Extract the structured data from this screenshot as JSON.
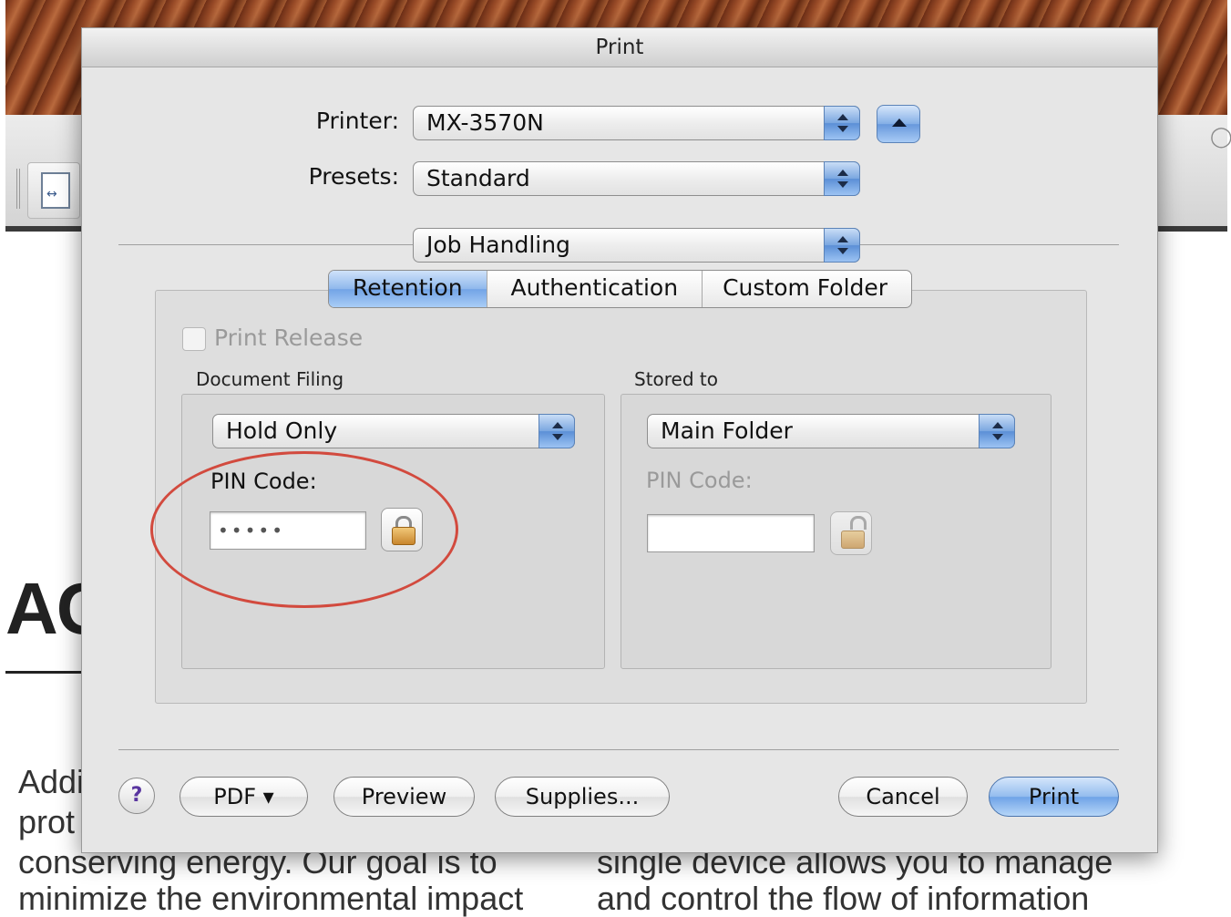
{
  "background": {
    "heading": "AG",
    "text_left": [
      "Addi",
      "prot",
      "conserving energy. Our goal is to",
      "minimize the environmental impact"
    ],
    "text_right": [
      "single device allows you to manage",
      "and control the flow of information"
    ]
  },
  "dialog": {
    "title": "Print",
    "printer_label": "Printer:",
    "printer_value": "MX-3570N",
    "presets_label": "Presets:",
    "presets_value": "Standard",
    "section_value": "Job Handling",
    "tabs": [
      {
        "label": "Retention",
        "active": true
      },
      {
        "label": "Authentication",
        "active": false
      },
      {
        "label": "Custom Folder",
        "active": false
      }
    ],
    "print_release_label": "Print Release",
    "document_filing": {
      "label": "Document Filing",
      "mode": "Hold Only",
      "pin_label": "PIN Code:",
      "pin_value": "•••••"
    },
    "stored_to": {
      "label": "Stored to",
      "folder": "Main Folder",
      "pin_label": "PIN Code:",
      "pin_value": ""
    },
    "buttons": {
      "help": "?",
      "pdf": "PDF ▾",
      "preview": "Preview",
      "supplies": "Supplies...",
      "cancel": "Cancel",
      "print": "Print"
    }
  },
  "colors": {
    "annotation": "#d24a3e",
    "aqua_blue": "#72a3e6"
  }
}
